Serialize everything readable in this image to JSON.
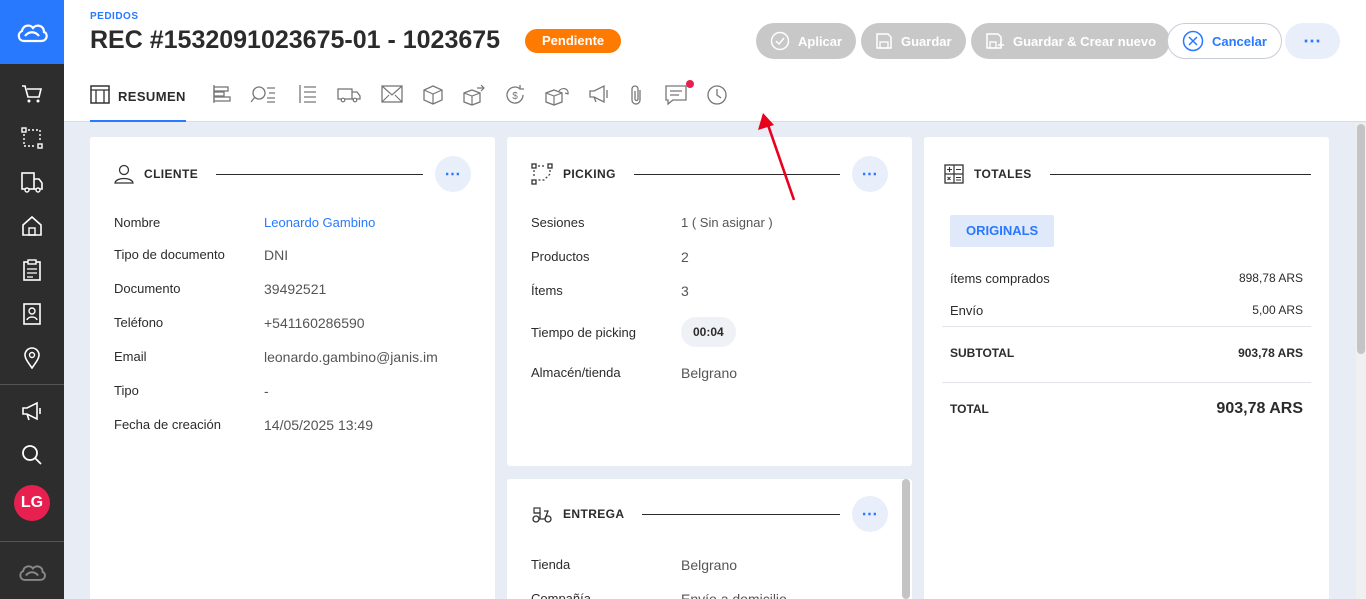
{
  "header": {
    "breadcrumb": "PEDIDOS",
    "title": "REC #1532091023675-01 - 1023675",
    "status": "Pendiente",
    "buttons": {
      "apply": "Aplicar",
      "save": "Guardar",
      "save_new": "Guardar & Crear nuevo",
      "cancel": "Cancelar",
      "more": "⋯"
    },
    "tabs": [
      {
        "label": "RESUMEN",
        "icon": "table-icon",
        "active": true
      },
      {
        "label": "",
        "icon": "items-icon"
      },
      {
        "label": "",
        "icon": "search-list-icon"
      },
      {
        "label": "",
        "icon": "list-icon"
      },
      {
        "label": "",
        "icon": "truck-icon"
      },
      {
        "label": "",
        "icon": "envelope-icon"
      },
      {
        "label": "",
        "icon": "box-icon"
      },
      {
        "label": "",
        "icon": "box-arrow-icon"
      },
      {
        "label": "",
        "icon": "money-refresh-icon"
      },
      {
        "label": "",
        "icon": "box-return-icon"
      },
      {
        "label": "",
        "icon": "megaphone-icon"
      },
      {
        "label": "",
        "icon": "paperclip-icon"
      },
      {
        "label": "",
        "icon": "comment-icon",
        "notification": true
      },
      {
        "label": "",
        "icon": "clock-icon"
      }
    ]
  },
  "sidebar": {
    "items": [
      "cart-icon",
      "route-icon",
      "delivery-icon",
      "home-icon",
      "clipboard-icon",
      "contact-icon",
      "location-icon",
      "megaphone-icon",
      "search-icon"
    ],
    "avatar": "LG"
  },
  "cliente": {
    "title": "CLIENTE",
    "rows": [
      {
        "k": "Nombre",
        "v": "Leonardo Gambino"
      },
      {
        "k": "Tipo de documento",
        "v": "DNI"
      },
      {
        "k": "Documento",
        "v": "39492521"
      },
      {
        "k": "Teléfono",
        "v": "+541160286590"
      },
      {
        "k": "Email",
        "v": "leonardo.gambino@janis.im"
      },
      {
        "k": "Tipo",
        "v": "-"
      },
      {
        "k": "Fecha de creación",
        "v": "14/05/2025 13:49"
      }
    ]
  },
  "picking": {
    "title": "PICKING",
    "rows": [
      {
        "k": "Sesiones",
        "v": "1 ( Sin asignar )"
      },
      {
        "k": "Productos",
        "v": "2"
      },
      {
        "k": "Ítems",
        "v": "3"
      },
      {
        "k": "Tiempo de picking",
        "v": "00:04"
      },
      {
        "k": "Almacén/tienda",
        "v": "Belgrano"
      }
    ]
  },
  "entrega": {
    "title": "ENTREGA",
    "rows": [
      {
        "k": "Tienda",
        "v": "Belgrano"
      },
      {
        "k": "Compañía",
        "v": "Envío a domicilio"
      }
    ]
  },
  "totales": {
    "title": "TOTALES",
    "originals": "ORIGINALS",
    "rows": [
      {
        "k": "ítems comprados",
        "v": "898,78 ARS"
      },
      {
        "k": "Envío",
        "v": "5,00 ARS"
      },
      {
        "k": "SUBTOTAL",
        "v": "903,78 ARS"
      },
      {
        "k": "TOTAL",
        "v": "903,78 ARS"
      }
    ]
  },
  "colors": {
    "accent": "#2979ff",
    "status": "#ff7a00",
    "annotation_arrow": "#e8001c"
  }
}
